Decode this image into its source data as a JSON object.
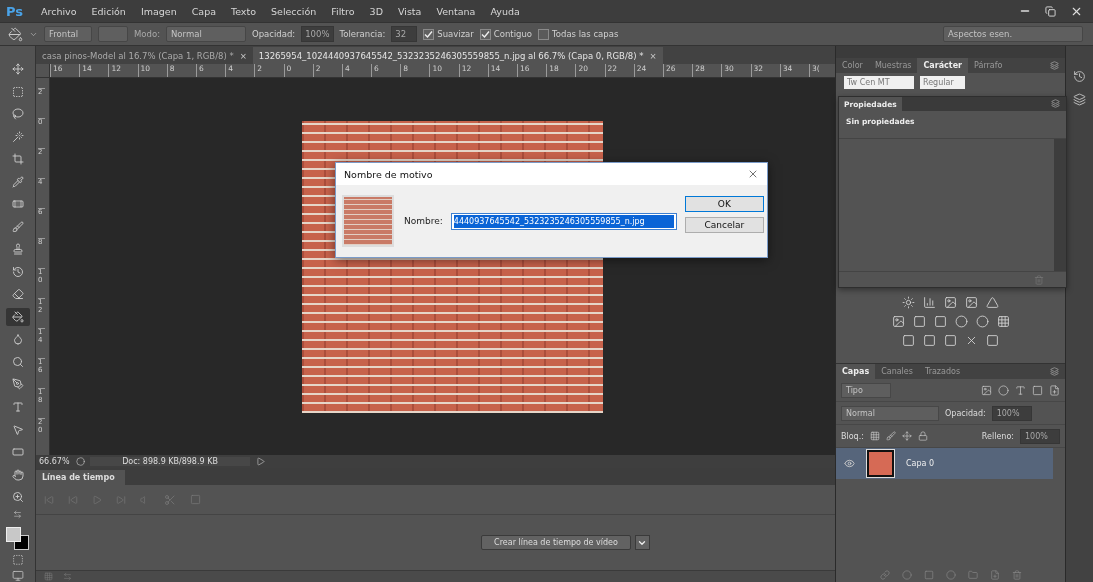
{
  "menu_bar": {
    "logo": "Ps",
    "items": [
      "Archivo",
      "Edición",
      "Imagen",
      "Capa",
      "Texto",
      "Selección",
      "Filtro",
      "3D",
      "Vista",
      "Ventana",
      "Ayuda"
    ]
  },
  "options_bar": {
    "preset": "Frontal",
    "mode_label": "Modo:",
    "mode": "Normal",
    "opacity_label": "Opacidad:",
    "opacity": "100%",
    "tolerance_label": "Tolerancia:",
    "tolerance": "32",
    "checkboxes": [
      {
        "label": "Suavizar",
        "checked": true
      },
      {
        "label": "Contiguo",
        "checked": true
      },
      {
        "label": "Todas las capas",
        "checked": false
      }
    ],
    "workspace": "Aspectos esen."
  },
  "document_tabs": [
    {
      "title": "casa pinos-Model al 16.7% (Capa 1, RGB/8) *",
      "close": "×",
      "selected": false
    },
    {
      "title": "13265954_1024440937645542_5323235246305559855_n.jpg al 66.7% (Capa 0, RGB/8) *",
      "close": "×",
      "selected": true
    }
  ],
  "ruler": {
    "x_labels": [
      "16",
      "14",
      "12",
      "10",
      "8",
      "6",
      "4",
      "2",
      "0",
      "2",
      "4",
      "6",
      "8",
      "10",
      "12",
      "14",
      "16",
      "18",
      "20",
      "22",
      "24",
      "26",
      "28",
      "30",
      "32",
      "34",
      "3("
    ],
    "y_labels": [
      "2",
      "0",
      "2",
      "4",
      "6",
      "8",
      "10",
      "12",
      "14",
      "16",
      "18",
      "20"
    ]
  },
  "tools": [
    {
      "kind": "move",
      "selected": false
    },
    {
      "kind": "marquee",
      "selected": false
    },
    {
      "kind": "lasso",
      "selected": false
    },
    {
      "kind": "wand",
      "selected": false
    },
    {
      "kind": "crop",
      "selected": false
    },
    {
      "kind": "eyedropper",
      "selected": false
    },
    {
      "kind": "healing",
      "selected": false
    },
    {
      "kind": "brush",
      "selected": false
    },
    {
      "kind": "stamp",
      "selected": false
    },
    {
      "kind": "history",
      "selected": false
    },
    {
      "kind": "eraser",
      "selected": false
    },
    {
      "kind": "bucket",
      "selected": true
    },
    {
      "kind": "blur",
      "selected": false
    },
    {
      "kind": "dodge",
      "selected": false
    },
    {
      "kind": "pen",
      "selected": false
    },
    {
      "kind": "type",
      "selected": false
    },
    {
      "kind": "select",
      "selected": false
    },
    {
      "kind": "shape",
      "selected": false
    },
    {
      "kind": "hand",
      "selected": false
    },
    {
      "kind": "zoom",
      "selected": false
    }
  ],
  "dialog": {
    "title": "Nombre de motivo",
    "name_label": "Nombre:",
    "name_value": "4440937645542_5323235246305559855_n.jpg",
    "buttons": [
      "OK",
      "Cancelar"
    ]
  },
  "status_bar": {
    "zoom": "66.67%",
    "doc": "Doc: 898.9 KB/898.9 KB"
  },
  "timeline": {
    "tab": "Línea de tiempo",
    "create_button": "Crear línea de tiempo de vídeo"
  },
  "character_panel": {
    "tabs": [
      {
        "label": "Color",
        "selected": false
      },
      {
        "label": "Muestras",
        "selected": false
      },
      {
        "label": "Carácter",
        "selected": true
      },
      {
        "label": "Párrafo",
        "selected": false
      }
    ],
    "font": "Tw Cen MT",
    "style": "Regular"
  },
  "properties_panel": {
    "tab": "Propiedades",
    "message": "Sin propiedades"
  },
  "layers_panel": {
    "tabs": [
      {
        "label": "Capas",
        "selected": true
      },
      {
        "label": "Canales",
        "selected": false
      },
      {
        "label": "Trazados",
        "selected": false
      }
    ],
    "filter": "Tipo",
    "blend_mode": "Normal",
    "opacity_label": "Opacidad:",
    "opacity": "100%",
    "lock_label": "Bloq.:",
    "fill_label": "Relleno:",
    "fill": "100%",
    "layers": [
      {
        "name": "Capa 0",
        "selected": true,
        "visible": true
      }
    ]
  }
}
